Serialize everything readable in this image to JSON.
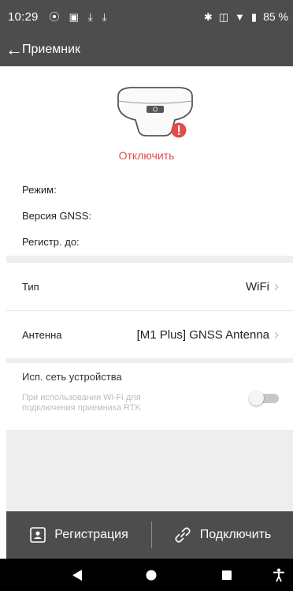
{
  "status_bar": {
    "time": "10:29",
    "battery": "85 %"
  },
  "app_bar": {
    "title": "Приемник"
  },
  "receiver": {
    "disconnect_label": "Отключить",
    "mode_label": "Режим:",
    "gnss_version_label": "Версия GNSS:",
    "registered_until_label": "Регистр. до:"
  },
  "settings": {
    "type_label": "Тип",
    "type_value": "WiFi",
    "antenna_label": "Антенна",
    "antenna_value": "[M1 Plus] GNSS Antenna"
  },
  "network": {
    "title": "Исп. сеть устройства",
    "description": "При использовании Wi-Fi для подключения приемника RTK",
    "toggle_on": false
  },
  "bottom_actions": {
    "register_label": "Регистрация",
    "connect_label": "Подключить"
  },
  "colors": {
    "bar": "#4d4d4d",
    "alert": "#e44b4b",
    "background_grey": "#eeeeee"
  }
}
